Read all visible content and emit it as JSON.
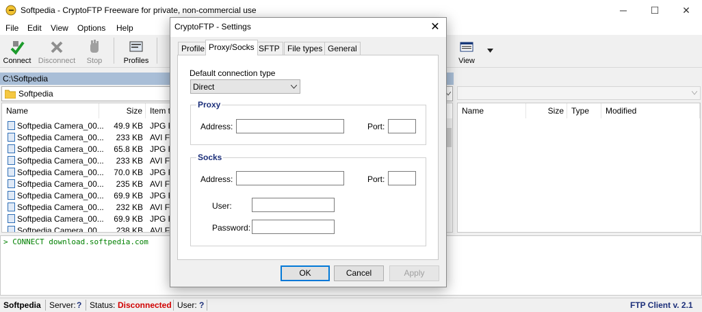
{
  "window": {
    "title": "Softpedia - CryptoFTP  Freeware for private, non-commercial use",
    "minimize_glyph": "─",
    "maximize_glyph": "☐",
    "close_glyph": "✕"
  },
  "menu": [
    "File",
    "Edit",
    "View",
    "Options",
    "Help"
  ],
  "toolbar": {
    "connect": "Connect",
    "disconnect": "Disconnect",
    "stop": "Stop",
    "profiles": "Profiles",
    "view": "View"
  },
  "local": {
    "path": "C:\\Softpedia",
    "folder": "Softpedia",
    "columns": [
      "Name",
      "Size",
      "Item t"
    ],
    "rows": [
      {
        "name": "Softpedia Camera_00...",
        "size": "49.9 KB",
        "type": "JPG Fi"
      },
      {
        "name": "Softpedia Camera_00...",
        "size": "233 KB",
        "type": "AVI Fi"
      },
      {
        "name": "Softpedia Camera_00...",
        "size": "65.8 KB",
        "type": "JPG Fi"
      },
      {
        "name": "Softpedia Camera_00...",
        "size": "233 KB",
        "type": "AVI Fi"
      },
      {
        "name": "Softpedia Camera_00...",
        "size": "70.0 KB",
        "type": "JPG Fi"
      },
      {
        "name": "Softpedia Camera_00...",
        "size": "235 KB",
        "type": "AVI Fi"
      },
      {
        "name": "Softpedia Camera_00...",
        "size": "69.9 KB",
        "type": "JPG Fi"
      },
      {
        "name": "Softpedia Camera_00...",
        "size": "232 KB",
        "type": "AVI Fi"
      },
      {
        "name": "Softpedia Camera_00...",
        "size": "69.9 KB",
        "type": "JPG Fi"
      },
      {
        "name": "Softpedia Camera_00...",
        "size": "238 KB",
        "type": "AVI Fi"
      }
    ]
  },
  "remote": {
    "columns": [
      "Name",
      "Size",
      "Type",
      "Modified"
    ]
  },
  "log": {
    "line": "> CONNECT download.softpedia.com"
  },
  "status": {
    "name": "Softpedia",
    "server_label": "Server:",
    "server_value": "?",
    "status_label": "Status:",
    "status_value": "Disconnected",
    "user_label": "User:",
    "user_value": "?",
    "version": "FTP Client v. 2.1"
  },
  "dialog": {
    "title": "CryptoFTP - Settings",
    "close_glyph": "✕",
    "tabs": [
      "Profile",
      "Proxy/Socks",
      "SFTP",
      "File types",
      "General"
    ],
    "active_tab": "Proxy/Socks",
    "conn_type_label": "Default connection type",
    "conn_type_value": "Direct",
    "proxy": {
      "group": "Proxy",
      "address_label": "Address:",
      "port_label": "Port:"
    },
    "socks": {
      "group": "Socks",
      "address_label": "Address:",
      "port_label": "Port:",
      "user_label": "User:",
      "password_label": "Password:"
    },
    "buttons": {
      "ok": "OK",
      "cancel": "Cancel",
      "apply": "Apply"
    }
  },
  "colors": {
    "path_bar": "#a9bed7",
    "status_disconnected": "#d10000",
    "status_highlight": "#1c2f7a",
    "log_text": "#008000",
    "focus_blue": "#0078d7"
  }
}
